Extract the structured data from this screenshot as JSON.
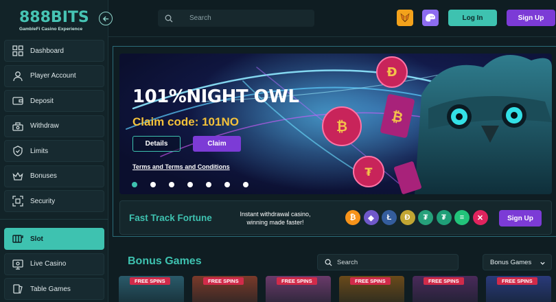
{
  "brand": {
    "name": "888BITS",
    "tagline": "GambleFi Casino Experience"
  },
  "sidebar": {
    "items": [
      {
        "label": "Dashboard",
        "icon": "grid-icon"
      },
      {
        "label": "Player Account",
        "icon": "user-icon"
      },
      {
        "label": "Deposit",
        "icon": "wallet-icon"
      },
      {
        "label": "Withdraw",
        "icon": "cash-icon"
      },
      {
        "label": "Limits",
        "icon": "limits-icon"
      },
      {
        "label": "Bonuses",
        "icon": "crown-icon"
      },
      {
        "label": "Security",
        "icon": "security-icon"
      }
    ],
    "games_items": [
      {
        "label": "Slot",
        "icon": "slot-icon",
        "active": true
      },
      {
        "label": "Live Casino",
        "icon": "live-icon"
      },
      {
        "label": "Table Games",
        "icon": "cards-icon"
      }
    ]
  },
  "header": {
    "search_placeholder": "Search",
    "login_label": "Log In",
    "signup_label": "Sign Up"
  },
  "banner": {
    "title": "101%NIGHT OWL",
    "code": "Claim code: 101NO",
    "details_label": "Details",
    "claim_label": "Claim",
    "terms_label": "Terms and Terms and Conditions",
    "slide_count": 7,
    "active_slide": 0
  },
  "fast_track": {
    "title": "Fast Track Fortune",
    "subtitle": "Instant withdrawal casino, winning made faster!",
    "signup_label": "Sign Up",
    "coins": [
      {
        "name": "bitcoin-icon",
        "symbol": "₿",
        "color": "#f7931a"
      },
      {
        "name": "ethereum-icon",
        "symbol": "◆",
        "color": "#6f58c9"
      },
      {
        "name": "litecoin-icon",
        "symbol": "Ł",
        "color": "#345d9d"
      },
      {
        "name": "dogecoin-icon",
        "symbol": "Ð",
        "color": "#c2a633"
      },
      {
        "name": "usdt-icon",
        "symbol": "₮",
        "color": "#26a17b"
      },
      {
        "name": "tron-icon",
        "symbol": "₮",
        "color": "#1f9f78"
      },
      {
        "name": "solana-icon",
        "symbol": "≡",
        "color": "#22c37a"
      },
      {
        "name": "xrp-icon",
        "symbol": "✕",
        "color": "#e0245e"
      }
    ]
  },
  "bonus_games": {
    "title": "Bonus Games",
    "search_placeholder": "Search",
    "filter_value": "Bonus Games",
    "tag_label": "FREE SPINS",
    "tiles": [
      {
        "color": "#2a5a6a"
      },
      {
        "color": "#7a3a2a"
      },
      {
        "color": "#6a3a6a"
      },
      {
        "color": "#6a4a1a"
      },
      {
        "color": "#4a2a5a"
      },
      {
        "color": "#2a3a7a"
      }
    ]
  }
}
